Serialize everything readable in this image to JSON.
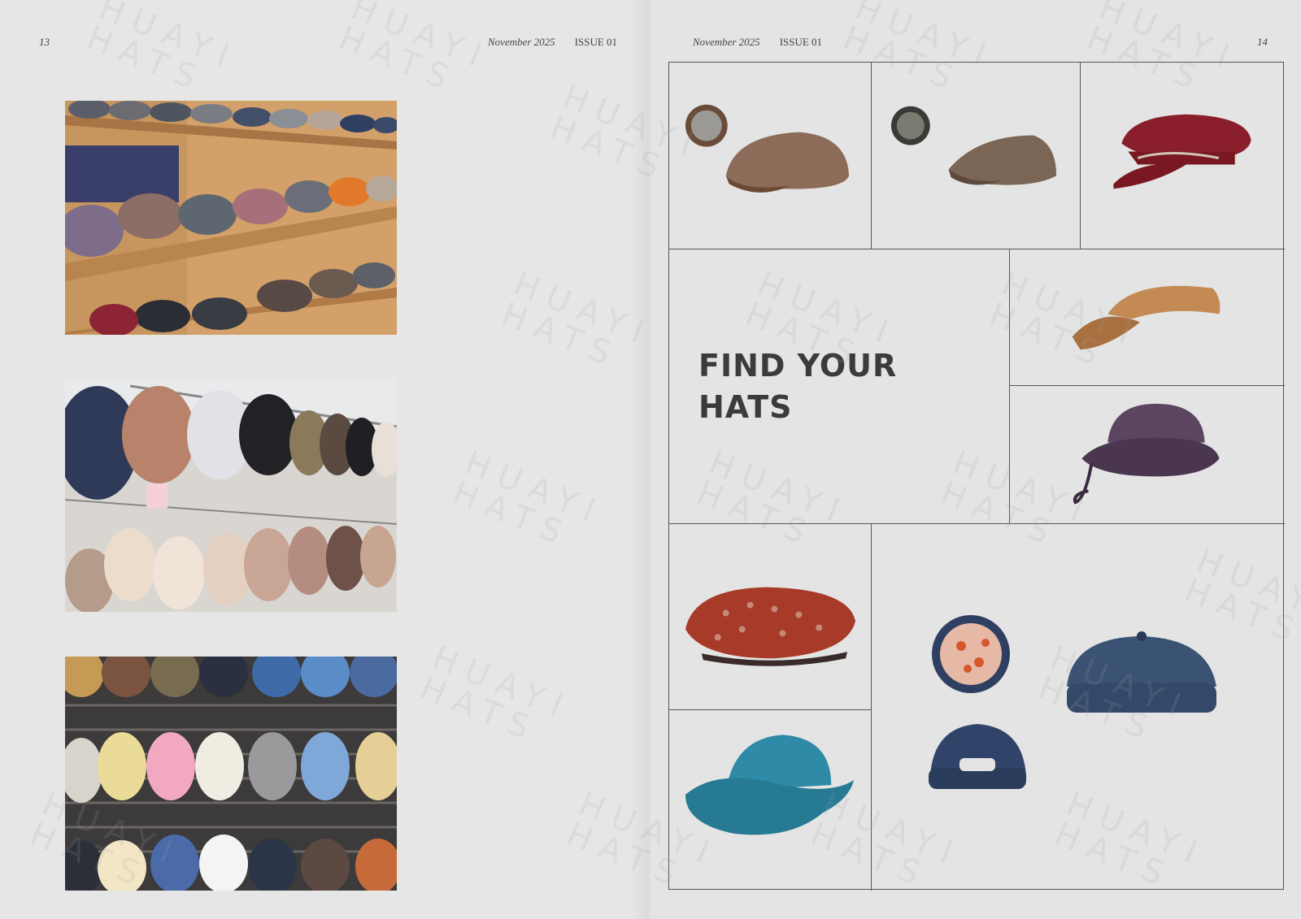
{
  "magazine": {
    "date": "November 2025",
    "issue": "ISSUE 01"
  },
  "left_page": {
    "page_number": "13",
    "photos": [
      {
        "subject": "flat caps on wooden shelves"
      },
      {
        "subject": "caps hanging on display hooks"
      },
      {
        "subject": "baseball caps on slatwall display"
      }
    ]
  },
  "right_page": {
    "page_number": "14",
    "headline_line1": "FIND YOUR",
    "headline_line2": "HATS",
    "products": [
      {
        "name": "brown tweed newsboy cap",
        "color": "#7a5f4a"
      },
      {
        "name": "plaid flat cap",
        "color": "#7b6554"
      },
      {
        "name": "burgundy corduroy fisherman cap",
        "color": "#8a1f2b"
      },
      {
        "name": "tan visor",
        "color": "#b07b45"
      },
      {
        "name": "purple bucket hat",
        "color": "#5b4560"
      },
      {
        "name": "red tweed beret",
        "color": "#a83a2a"
      },
      {
        "name": "teal terry cowboy hat",
        "color": "#2e8aa6"
      },
      {
        "name": "blue wool docker cap",
        "color": "#3a5273"
      }
    ]
  },
  "watermark": "HUAYI\nHATS"
}
